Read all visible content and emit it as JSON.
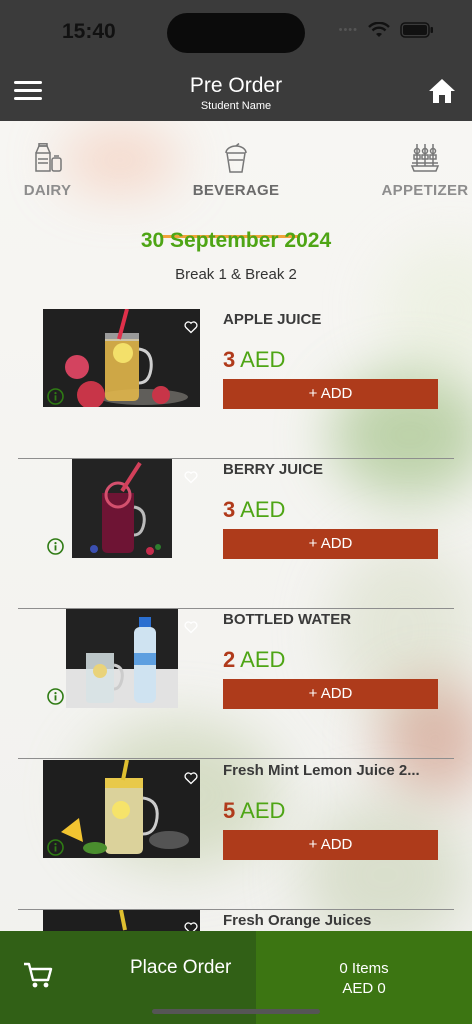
{
  "status": {
    "time": "15:40"
  },
  "header": {
    "title": "Pre Order",
    "subtitle": "Student Name"
  },
  "categories": [
    {
      "label": "DAIRY",
      "icon": "milk-carton-icon"
    },
    {
      "label": "BEVERAGE",
      "icon": "drink-cup-icon",
      "active": true
    },
    {
      "label": "APPETIZER",
      "icon": "skewers-icon"
    }
  ],
  "date": "30 September 2024",
  "breaks": "Break 1 & Break 2",
  "items": [
    {
      "name": "APPLE JUICE",
      "price": "3",
      "currency": "AED",
      "add_label": "+ ADD"
    },
    {
      "name": "BERRY JUICE",
      "price": "3",
      "currency": "AED",
      "add_label": "+ ADD"
    },
    {
      "name": "BOTTLED WATER",
      "price": "2",
      "currency": "AED",
      "add_label": "+ ADD"
    },
    {
      "name": "Fresh Mint Lemon Juice 2...",
      "price": "5",
      "currency": "AED",
      "add_label": "+ ADD"
    },
    {
      "name": "Fresh Orange Juices"
    }
  ],
  "footer": {
    "place_order": "Place Order",
    "items_count": "0 Items",
    "total": "AED 0"
  },
  "colors": {
    "bar": "#3b3b3b",
    "green": "#4ea515",
    "add_button": "#ae3b1b",
    "place_order_bg": "#316016",
    "summary_bg": "#3c7512",
    "underline": "#f0a33a"
  }
}
